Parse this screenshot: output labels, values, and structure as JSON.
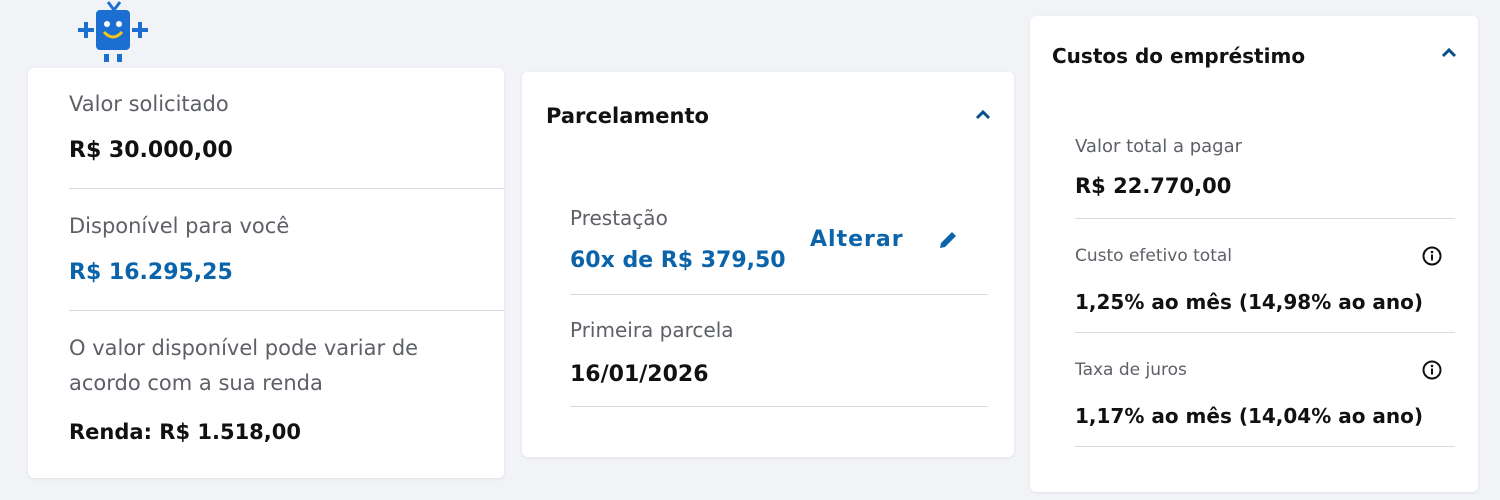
{
  "colors": {
    "accent": "#0b63a9",
    "text": "#111111",
    "muted": "#5d6066",
    "divider": "#d8dbe3"
  },
  "icons": {
    "mascot": "mascot-icon",
    "collapse": "chevron-up-icon",
    "edit": "pencil-icon",
    "info": "info-icon"
  },
  "left": {
    "requested_label": "Valor solicitado",
    "requested_value": "R$ 30.000,00",
    "available_label": "Disponível para você",
    "available_value": "R$ 16.295,25",
    "note_line1": "O valor disponível pode variar de",
    "note_line2": "acordo com a sua renda",
    "income": "Renda: R$ 1.518,00"
  },
  "installments": {
    "title": "Parcelamento",
    "payment_label": "Prestação",
    "payment_value": "60x de R$ 379,50",
    "change_label": "Alterar",
    "first_label": "Primeira parcela",
    "first_value": "16/01/2026"
  },
  "costs": {
    "title": "Custos do empréstimo",
    "total_label": "Valor total a pagar",
    "total_value": "R$ 22.770,00",
    "cet_label": "Custo efetivo total",
    "cet_value": "1,25% ao mês (14,98% ao ano)",
    "rate_label": "Taxa de juros",
    "rate_value": "1,17% ao mês (14,04% ao ano)"
  }
}
